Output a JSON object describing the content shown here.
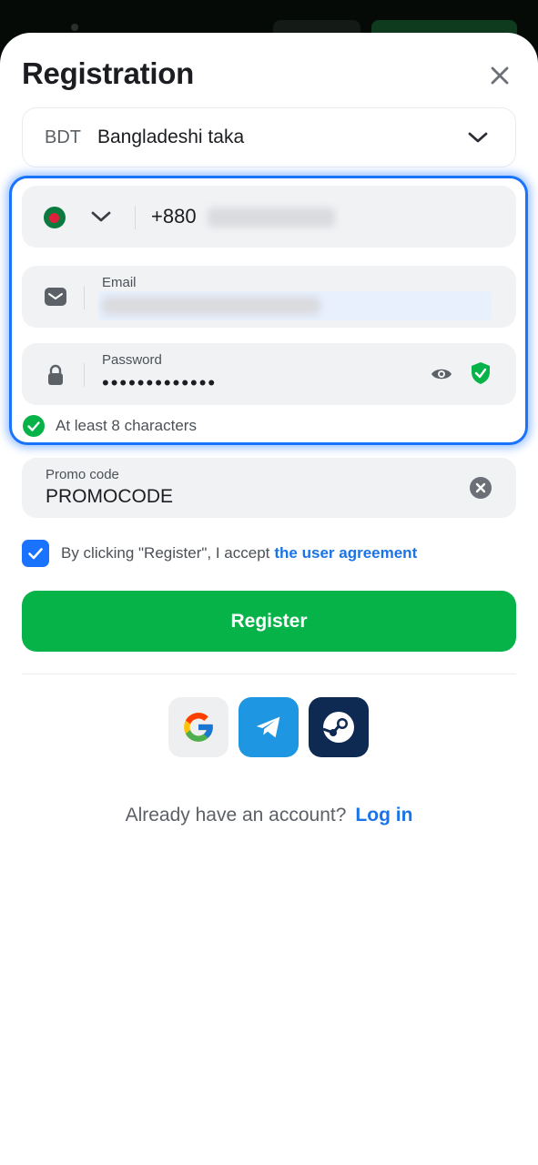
{
  "title": "Registration",
  "currency": {
    "code": "BDT",
    "name": "Bangladeshi taka"
  },
  "phone": {
    "prefix": "+880",
    "country_flag": "bangladesh-flag"
  },
  "email": {
    "label": "Email"
  },
  "password": {
    "label": "Password",
    "masked_value": "•••••••••••••"
  },
  "password_rule": "At least 8 characters",
  "promo": {
    "label": "Promo code",
    "value": "PROMOCODE"
  },
  "agreement": {
    "text": "By clicking \"Register\", I accept",
    "link": "the user agreement",
    "checked": true
  },
  "register_label": "Register",
  "social_providers": [
    "google",
    "telegram",
    "steam"
  ],
  "login": {
    "question": "Already have an account?",
    "link": "Log in"
  },
  "colors": {
    "accent_blue": "#1a73ff",
    "register_green": "#06b348",
    "link_blue": "#1a73e8"
  }
}
